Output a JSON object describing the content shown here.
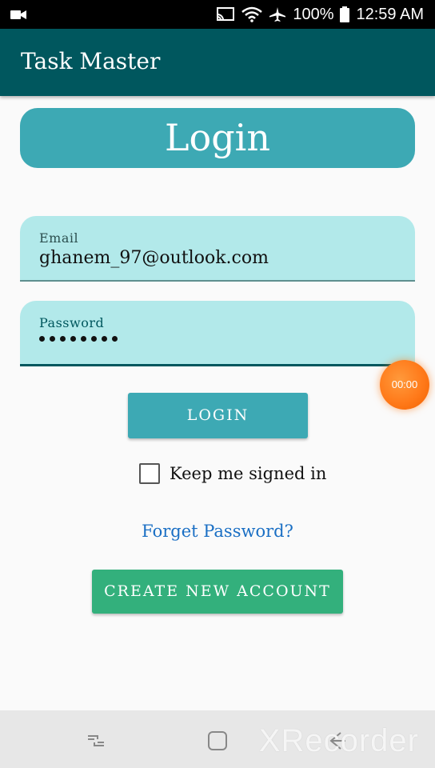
{
  "status_bar": {
    "battery_percent": "100%",
    "time": "12:59 AM"
  },
  "app_bar": {
    "title": "Task Master"
  },
  "login_header": {
    "title": "Login"
  },
  "email_field": {
    "label": "Email",
    "value": "ghanem_97@outlook.com"
  },
  "password_field": {
    "label": "Password",
    "masked_length": 8
  },
  "recorder_bubble": {
    "time": "00:00"
  },
  "buttons": {
    "login": "LOGIN",
    "create_account": "CREATE NEW ACCOUNT"
  },
  "keep_signed_in": {
    "label": "Keep me signed in",
    "checked": false
  },
  "forget_password": {
    "label": "Forget Password?"
  },
  "watermark": {
    "text": "XRecorder"
  },
  "colors": {
    "app_bar": "#00575e",
    "accent": "#3da9b4",
    "field_bg": "#b2e9ea",
    "create_button": "#33b07c",
    "link": "#1a6fc4"
  }
}
